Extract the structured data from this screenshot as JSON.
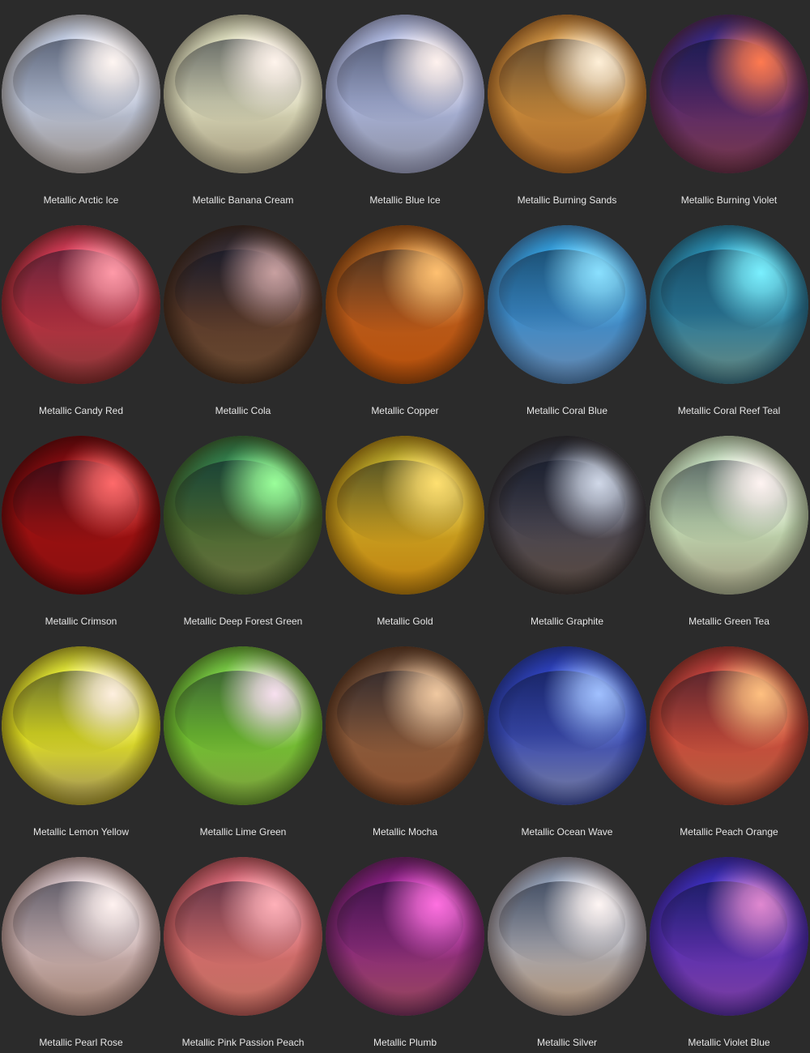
{
  "swatches": [
    {
      "name": "Metallic Arctic Ice",
      "colors": {
        "base": "#b9c3d9",
        "hi": "#fff6f2",
        "top": "#c9d6f0",
        "bottom": "#9a9088",
        "edge": "#6f6a68"
      }
    },
    {
      "name": "Metallic Banana Cream",
      "colors": {
        "base": "#d9d8b8",
        "hi": "#fff4ec",
        "top": "#e4e6c6",
        "bottom": "#a0967a",
        "edge": "#6e6a58"
      }
    },
    {
      "name": "Metallic Blue Ice",
      "colors": {
        "base": "#a8b2d8",
        "hi": "#fff2ee",
        "top": "#b8c4ee",
        "bottom": "#8c8fa0",
        "edge": "#62647a"
      }
    },
    {
      "name": "Metallic Burning Sands",
      "colors": {
        "base": "#c88a3a",
        "hi": "#fff0d8",
        "top": "#d59a4a",
        "bottom": "#a5652a",
        "edge": "#6a3f16"
      }
    },
    {
      "name": "Metallic Burning Violet",
      "colors": {
        "base": "#5a2a6a",
        "hi": "#ff7a50",
        "top": "#2a2a9a",
        "bottom": "#7a3a4a",
        "edge": "#3a1a2a"
      }
    },
    {
      "name": "Metallic Candy Red",
      "colors": {
        "base": "#b83040",
        "hi": "#ff9aa8",
        "top": "#e04060",
        "bottom": "#8a3a3a",
        "edge": "#501818"
      }
    },
    {
      "name": "Metallic Cola",
      "colors": {
        "base": "#5a3a2a",
        "hi": "#c8a0a0",
        "top": "#2a2a3a",
        "bottom": "#6a4a30",
        "edge": "#2a1a10"
      }
    },
    {
      "name": "Metallic Copper",
      "colors": {
        "base": "#b85a1a",
        "hi": "#ffc070",
        "top": "#a86a2a",
        "bottom": "#b8500a",
        "edge": "#5a2a08"
      }
    },
    {
      "name": "Metallic Coral Blue",
      "colors": {
        "base": "#3a8ac8",
        "hi": "#8ae0ff",
        "top": "#30a8e8",
        "bottom": "#6a8ab0",
        "edge": "#2a4a6a"
      }
    },
    {
      "name": "Metallic Coral Reef Teal",
      "colors": {
        "base": "#2a7a9a",
        "hi": "#7af0ff",
        "top": "#2a9ac0",
        "bottom": "#6a8a80",
        "edge": "#1a4050"
      }
    },
    {
      "name": "Metallic Crimson",
      "colors": {
        "base": "#9a1010",
        "hi": "#ff6a6a",
        "top": "#7a0a10",
        "bottom": "#8a1010",
        "edge": "#400606"
      }
    },
    {
      "name": "Metallic Deep Forest Green",
      "colors": {
        "base": "#4a6a30",
        "hi": "#9aff9a",
        "top": "#2a8a5a",
        "bottom": "#6a7040",
        "edge": "#2a3a18"
      }
    },
    {
      "name": "Metallic Gold",
      "colors": {
        "base": "#c8a020",
        "hi": "#ffe070",
        "top": "#b8b030",
        "bottom": "#c08010",
        "edge": "#6a4a08"
      }
    },
    {
      "name": "Metallic Graphite",
      "colors": {
        "base": "#4a4650",
        "hi": "#d0d8e8",
        "top": "#2a3040",
        "bottom": "#5a4a40",
        "edge": "#201c1c"
      }
    },
    {
      "name": "Metallic Green Tea",
      "colors": {
        "base": "#c0d8b0",
        "hi": "#fff4f2",
        "top": "#c8e4c8",
        "bottom": "#a09a80",
        "edge": "#6a705a"
      }
    },
    {
      "name": "Metallic Lemon Yellow",
      "colors": {
        "base": "#e0e020",
        "hi": "#fff0e0",
        "top": "#e8f040",
        "bottom": "#a09060",
        "edge": "#6a6010"
      }
    },
    {
      "name": "Metallic Lime Green",
      "colors": {
        "base": "#70c030",
        "hi": "#f8e0f0",
        "top": "#80d850",
        "bottom": "#80a040",
        "edge": "#3a5a18"
      }
    },
    {
      "name": "Metallic Mocha",
      "colors": {
        "base": "#8a5a3a",
        "hi": "#f0c8a0",
        "top": "#6a5040",
        "bottom": "#8a5030",
        "edge": "#3a2010"
      }
    },
    {
      "name": "Metallic Ocean Wave",
      "colors": {
        "base": "#3a4ab0",
        "hi": "#a0c0ff",
        "top": "#2a40c8",
        "bottom": "#7a80a0",
        "edge": "#1a2460"
      }
    },
    {
      "name": "Metallic Peach Orange",
      "colors": {
        "base": "#c84a3a",
        "hi": "#ffc080",
        "top": "#c04040",
        "bottom": "#b06040",
        "edge": "#5a2018"
      }
    },
    {
      "name": "Metallic Pearl Rose",
      "colors": {
        "base": "#c8b0b0",
        "hi": "#fff2f0",
        "top": "#d8c8d0",
        "bottom": "#a08070",
        "edge": "#6a5550"
      }
    },
    {
      "name": "Metallic Pink Passion Peach",
      "colors": {
        "base": "#d06a6a",
        "hi": "#ffb0b8",
        "top": "#e06a80",
        "bottom": "#c07060",
        "edge": "#6a3030"
      }
    },
    {
      "name": "Metallic Plumb",
      "colors": {
        "base": "#8a2a7a",
        "hi": "#ff70e0",
        "top": "#8a1a8a",
        "bottom": "#9a4a5a",
        "edge": "#401838"
      }
    },
    {
      "name": "Metallic Silver",
      "colors": {
        "base": "#a8a8b0",
        "hi": "#fff6f4",
        "top": "#8aa0c0",
        "bottom": "#b09070",
        "edge": "#5a5050"
      }
    },
    {
      "name": "Metallic Violet Blue",
      "colors": {
        "base": "#5a30b0",
        "hi": "#e088d0",
        "top": "#3030c8",
        "bottom": "#8040a0",
        "edge": "#2a1860"
      }
    }
  ]
}
